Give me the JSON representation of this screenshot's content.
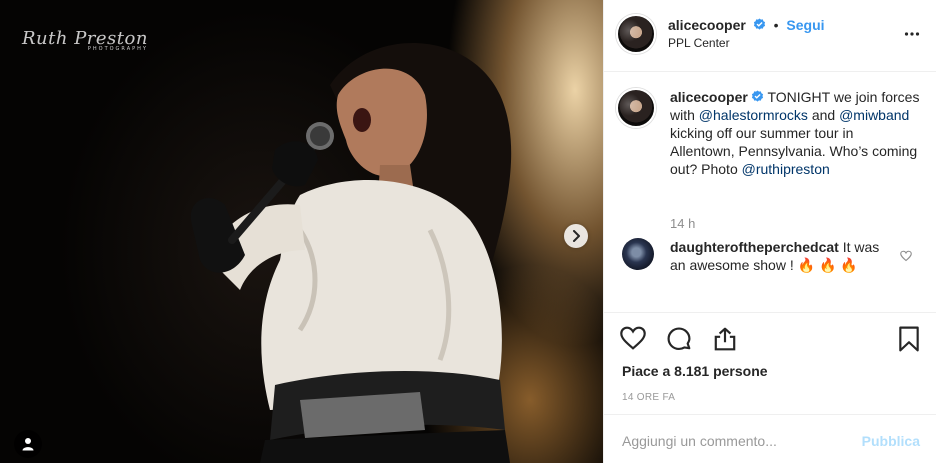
{
  "photo": {
    "watermark_name": "Ruth Preston",
    "watermark_sub": "PHOTOGRAPHY"
  },
  "header": {
    "username": "alicecooper",
    "separator": "•",
    "follow_label": "Segui",
    "location": "PPL Center",
    "more_icon": "more-horizontal-icon"
  },
  "caption": {
    "username": "alicecooper",
    "text_1": "TONIGHT we join forces with ",
    "mention_1": "@halestormrocks",
    "text_2": " and ",
    "mention_2": "@miwband",
    "text_3": " kicking off our summer tour in Allentown, Pennsylvania. Who’s coming out? Photo ",
    "mention_3": "@ruthipreston",
    "time_ago": "14 h"
  },
  "comments": [
    {
      "username": "daughteroftheperchedcat",
      "text": " It was an awesome show ! 🔥 🔥 🔥"
    }
  ],
  "likes_text": "Piace a 8.181 persone",
  "timestamp": "14 ORE FA",
  "comment_input": {
    "placeholder": "Aggiungi un commento...",
    "publish_label": "Pubblica"
  },
  "colors": {
    "accent": "#3897f0",
    "mention": "#003569",
    "publish_disabled": "#b2dffc",
    "muted": "#8e8e8e"
  }
}
